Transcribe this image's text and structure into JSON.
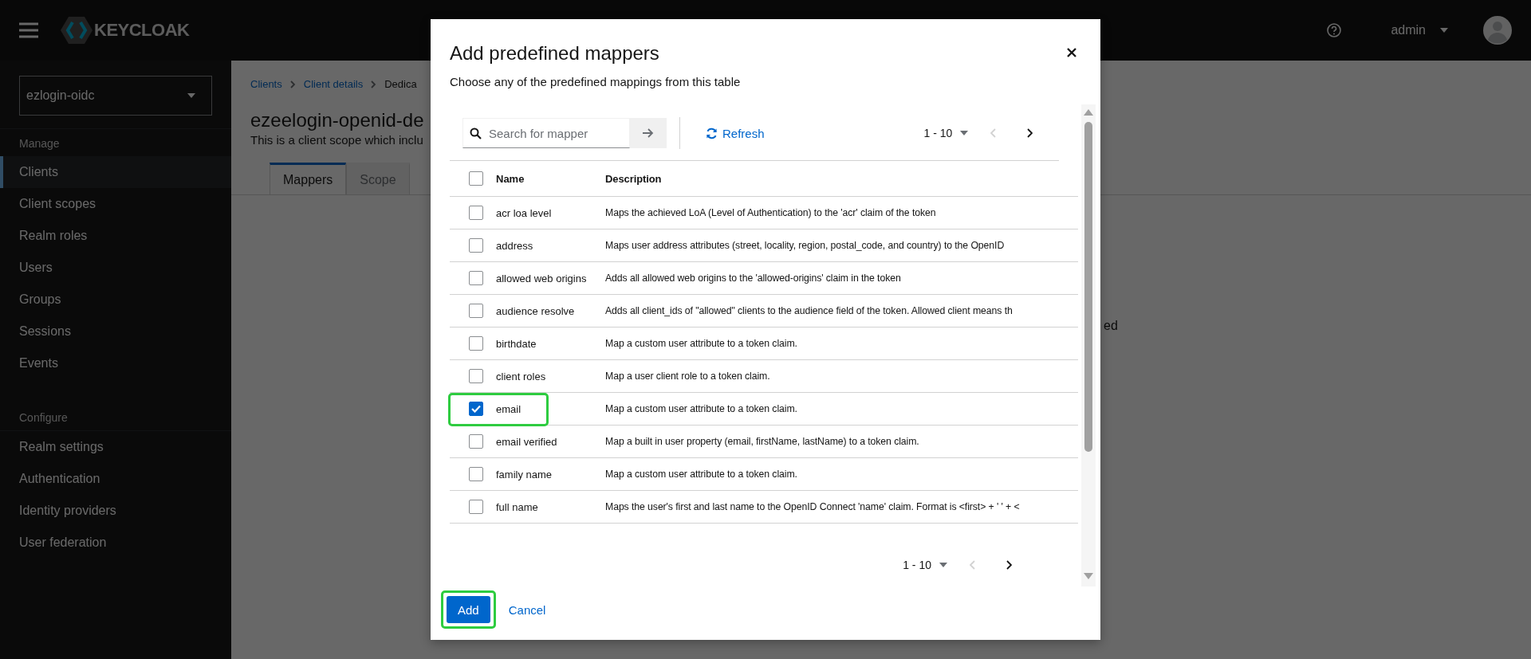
{
  "header": {
    "logo": "KEYCLOAK",
    "user": "admin"
  },
  "sidebar": {
    "realm": "ezlogin-oidc",
    "sections": [
      {
        "title": "Manage",
        "items": [
          {
            "label": "Clients",
            "selected": true
          },
          {
            "label": "Client scopes",
            "selected": false
          },
          {
            "label": "Realm roles",
            "selected": false
          },
          {
            "label": "Users",
            "selected": false
          },
          {
            "label": "Groups",
            "selected": false
          },
          {
            "label": "Sessions",
            "selected": false
          },
          {
            "label": "Events",
            "selected": false
          }
        ]
      },
      {
        "title": "Configure",
        "items": [
          {
            "label": "Realm settings",
            "selected": false
          },
          {
            "label": "Authentication",
            "selected": false
          },
          {
            "label": "Identity providers",
            "selected": false
          },
          {
            "label": "User federation",
            "selected": false
          }
        ]
      }
    ]
  },
  "page": {
    "breadcrumb": [
      {
        "label": "Clients",
        "current": false
      },
      {
        "label": "Client details",
        "current": false
      },
      {
        "label": "Dedica",
        "current": true
      }
    ],
    "title": "ezeelogin-openid-de",
    "subtitle": "This is a client scope which inclu",
    "tabs": [
      {
        "label": "Mappers",
        "selected": true
      },
      {
        "label": "Scope",
        "selected": false
      }
    ],
    "background_text_fragment": "ed"
  },
  "dialog": {
    "title": "Add predefined mappers",
    "subtitle": "Choose any of the predefined mappings from this table",
    "search": {
      "placeholder": "Search for mapper"
    },
    "refresh": "Refresh",
    "pagination_top": "1 - 10",
    "pagination_bottom": "1 - 10",
    "columns": [
      "Name",
      "Description"
    ],
    "select_all_checked": false,
    "rows": [
      {
        "name": "acr loa level",
        "description": "Maps the achieved LoA (Level of Authentication) to the 'acr' claim of the token",
        "checked": false,
        "highlighted": false
      },
      {
        "name": "address",
        "description": "Maps user address attributes (street, locality, region, postal_code, and country) to the OpenID",
        "checked": false,
        "highlighted": false
      },
      {
        "name": "allowed web origins",
        "description": "Adds all allowed web origins to the 'allowed-origins' claim in the token",
        "checked": false,
        "highlighted": false
      },
      {
        "name": "audience resolve",
        "description": "Adds all client_ids of \"allowed\" clients to the audience field of the token. Allowed client means th",
        "checked": false,
        "highlighted": false
      },
      {
        "name": "birthdate",
        "description": "Map a custom user attribute to a token claim.",
        "checked": false,
        "highlighted": false
      },
      {
        "name": "client roles",
        "description": "Map a user client role to a token claim.",
        "checked": false,
        "highlighted": false
      },
      {
        "name": "email",
        "description": "Map a custom user attribute to a token claim.",
        "checked": true,
        "highlighted": true
      },
      {
        "name": "email verified",
        "description": "Map a built in user property (email, firstName, lastName) to a token claim.",
        "checked": false,
        "highlighted": false
      },
      {
        "name": "family name",
        "description": "Map a custom user attribute to a token claim.",
        "checked": false,
        "highlighted": false
      },
      {
        "name": "full name",
        "description": "Maps the user's first and last name to the OpenID Connect 'name' claim. Format is <first> + ' ' + <",
        "checked": false,
        "highlighted": false
      }
    ],
    "buttons": [
      {
        "label": "Add",
        "kind": "primary",
        "highlighted": true
      },
      {
        "label": "Cancel",
        "kind": "link",
        "highlighted": false
      }
    ]
  }
}
